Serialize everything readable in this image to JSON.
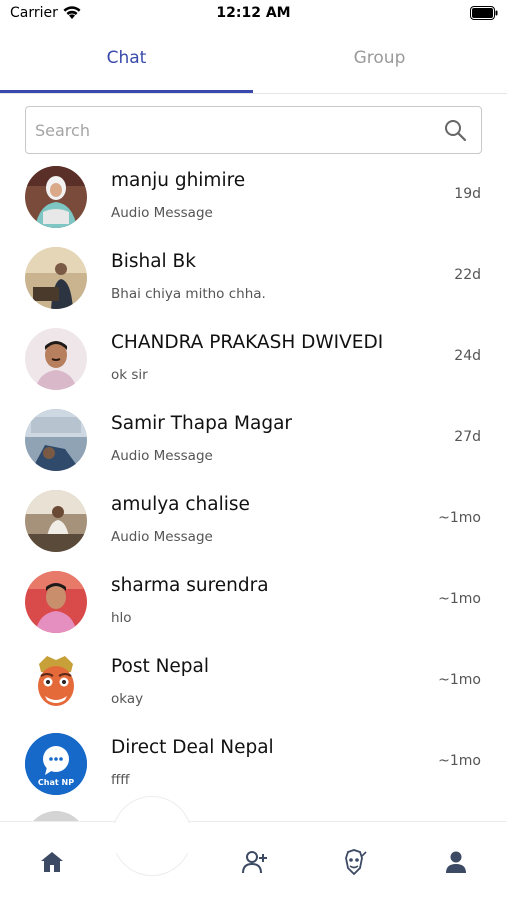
{
  "status_bar": {
    "carrier": "Carrier",
    "time": "12:12 AM"
  },
  "tabs": [
    {
      "label": "Chat",
      "active": true
    },
    {
      "label": "Group",
      "active": false
    }
  ],
  "search": {
    "placeholder": "Search",
    "value": ""
  },
  "colors": {
    "accent": "#3949ab",
    "nav_icon": "#3d4a63"
  },
  "chats": [
    {
      "name": "manju ghimire",
      "preview": "Audio Message",
      "time": "19d",
      "avatar": "photo-avatar"
    },
    {
      "name": "Bishal Bk",
      "preview": "Bhai chiya mitho chha.",
      "time": "22d",
      "avatar": "photo-avatar"
    },
    {
      "name": "CHANDRA PRAKASH DWIVEDI",
      "preview": "ok sir",
      "time": "24d",
      "avatar": "photo-avatar"
    },
    {
      "name": "Samir Thapa Magar",
      "preview": "Audio Message",
      "time": "27d",
      "avatar": "photo-avatar"
    },
    {
      "name": "amulya chalise",
      "preview": "Audio Message",
      "time": "~1mo",
      "avatar": "photo-avatar"
    },
    {
      "name": "sharma surendra",
      "preview": "hlo",
      "time": "~1mo",
      "avatar": "photo-avatar"
    },
    {
      "name": "Post Nepal",
      "preview": "okay",
      "time": "~1mo",
      "avatar": "mask-logo-avatar"
    },
    {
      "name": "Direct Deal Nepal",
      "preview": "ffff",
      "time": "~1mo",
      "avatar": "chat-np-logo-avatar"
    }
  ],
  "chat_np_logo_text": "Chat NP",
  "bottom_nav": [
    {
      "icon": "home-icon"
    },
    {
      "icon": "chat-bubble-icon",
      "active": true
    },
    {
      "icon": "add-person-icon"
    },
    {
      "icon": "mask-icon"
    },
    {
      "icon": "profile-icon"
    }
  ]
}
